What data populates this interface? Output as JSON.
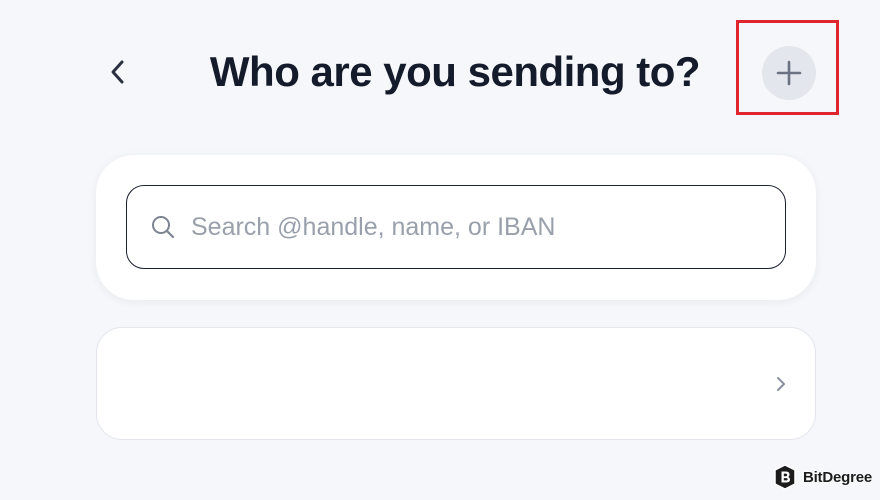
{
  "header": {
    "title": "Who are you sending to?",
    "back_icon": "chevron-left-icon",
    "add_icon": "plus-icon"
  },
  "search": {
    "placeholder": "Search @handle, name, or IBAN",
    "value": "",
    "icon": "search-icon"
  },
  "recipient_row": {
    "label": "",
    "icon": "chevron-right-icon"
  },
  "watermark": {
    "text": "BitDegree"
  },
  "colors": {
    "background": "#f6f7fa",
    "title": "#141c2b",
    "add_button_bg": "#e3e6ec",
    "highlight": "#e0262d",
    "placeholder": "#9aa0ab"
  }
}
